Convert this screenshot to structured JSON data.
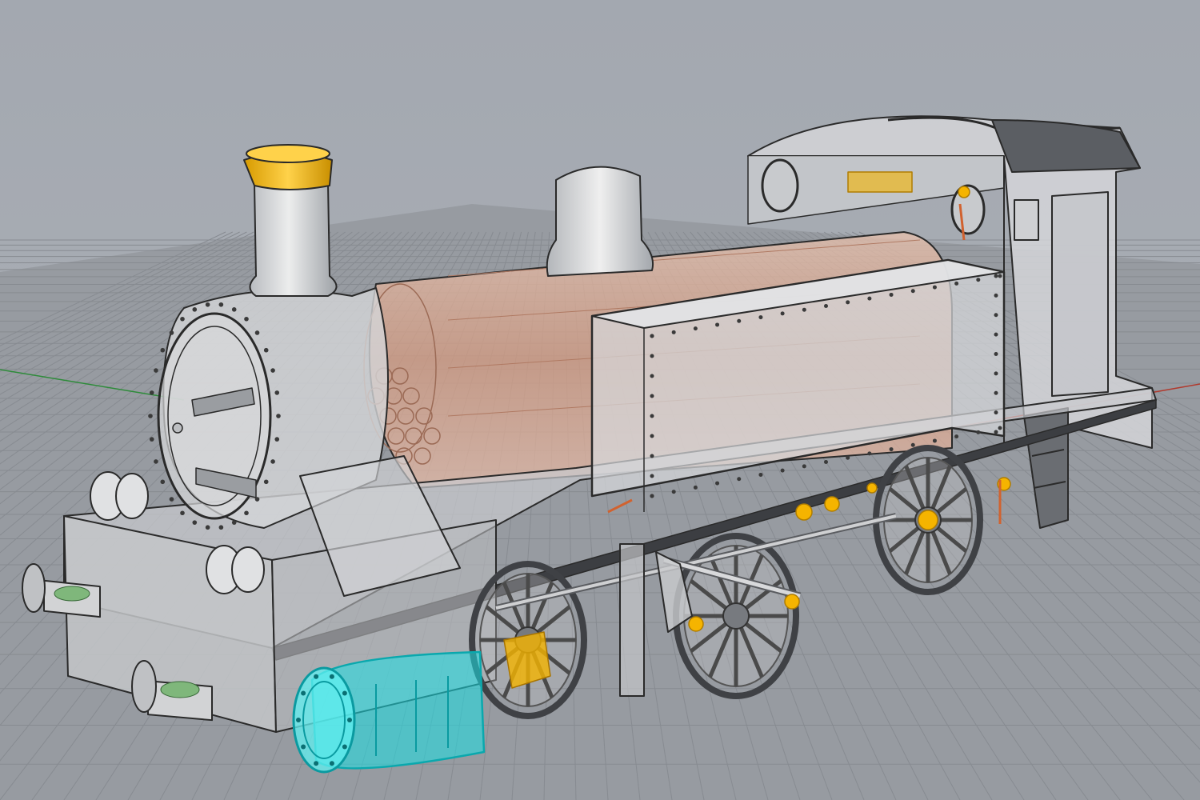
{
  "viewport": {
    "view_mode": "perspective-ghosted",
    "background_color": "#a9adb4",
    "grid_color": "#8e9299",
    "grid_line_color": "#7d8188",
    "axis_x_color": "#c0392b",
    "axis_y_color": "#2e8b3a"
  },
  "model": {
    "body_fill": "#d9dadc",
    "body_stroke": "#2a2a2a",
    "boiler_color": "#d8a48a",
    "chimney_cap_color": "#f2b705",
    "cylinder_highlight_color": "#19e0e6",
    "fitting_highlight_color": "#f5b400",
    "rivet_color": "#3a3a3a",
    "wheel_color": "#4a4a4a"
  }
}
